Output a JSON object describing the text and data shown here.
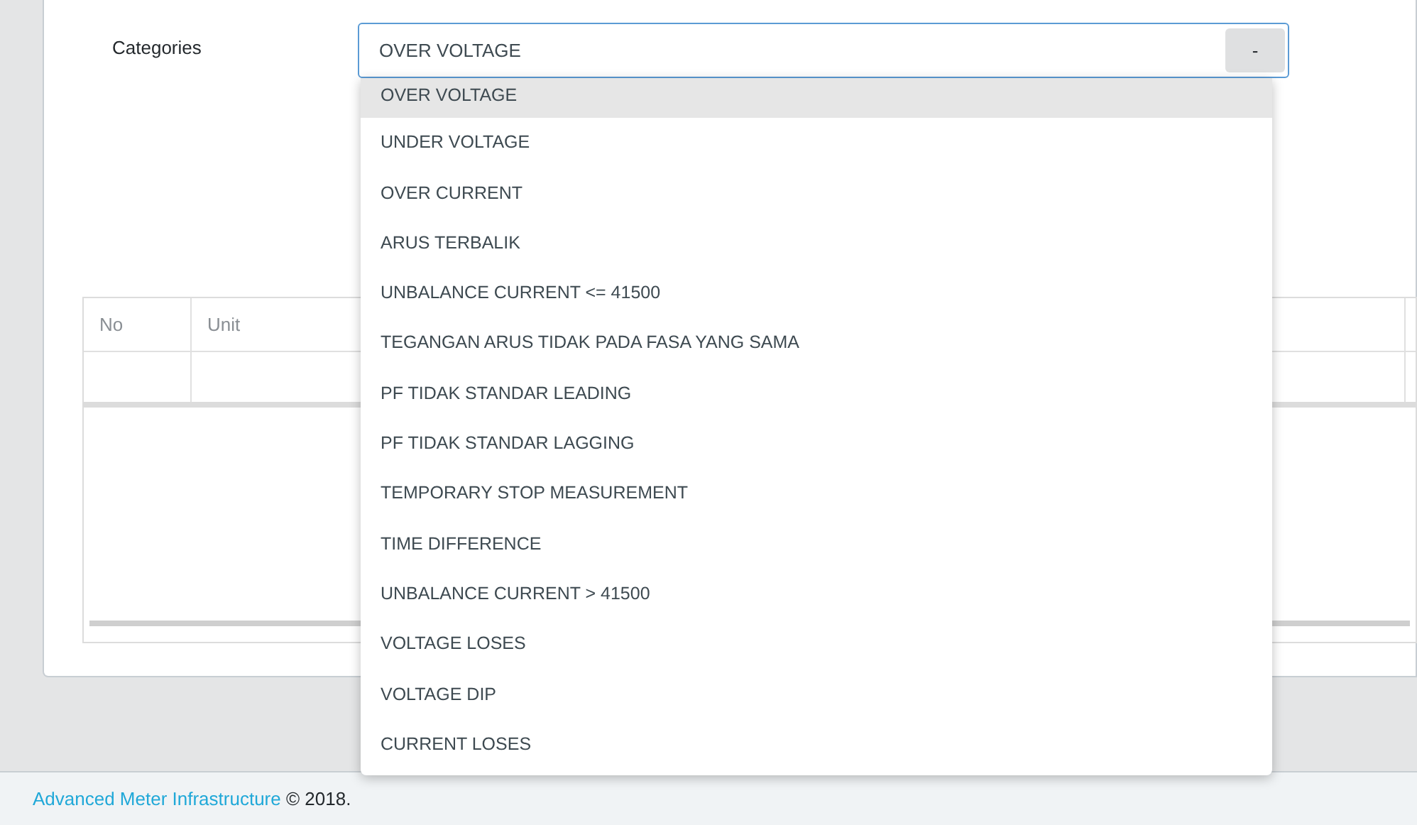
{
  "form": {
    "label": "Categories",
    "value": "OVER VOLTAGE",
    "toggle": "-"
  },
  "dropdown": [
    {
      "label": "OVER VOLTAGE",
      "selected": true
    },
    {
      "label": "UNDER VOLTAGE",
      "selected": false
    },
    {
      "label": "OVER CURRENT",
      "selected": false
    },
    {
      "label": "ARUS TERBALIK",
      "selected": false
    },
    {
      "label": "UNBALANCE CURRENT <= 41500",
      "selected": false
    },
    {
      "label": "TEGANGAN ARUS TIDAK PADA FASA YANG SAMA",
      "selected": false
    },
    {
      "label": "PF TIDAK STANDAR LEADING",
      "selected": false
    },
    {
      "label": "PF TIDAK STANDAR LAGGING",
      "selected": false
    },
    {
      "label": "TEMPORARY STOP MEASUREMENT",
      "selected": false
    },
    {
      "label": "TIME DIFFERENCE",
      "selected": false
    },
    {
      "label": "UNBALANCE CURRENT > 41500",
      "selected": false
    },
    {
      "label": "VOLTAGE LOSES",
      "selected": false
    },
    {
      "label": "VOLTAGE DIP",
      "selected": false
    },
    {
      "label": "CURRENT LOSES",
      "selected": false
    }
  ],
  "table": {
    "columns": [
      "No",
      "Unit"
    ]
  },
  "footer": {
    "link": "Advanced Meter Infrastructure",
    "text": "© 2018."
  }
}
